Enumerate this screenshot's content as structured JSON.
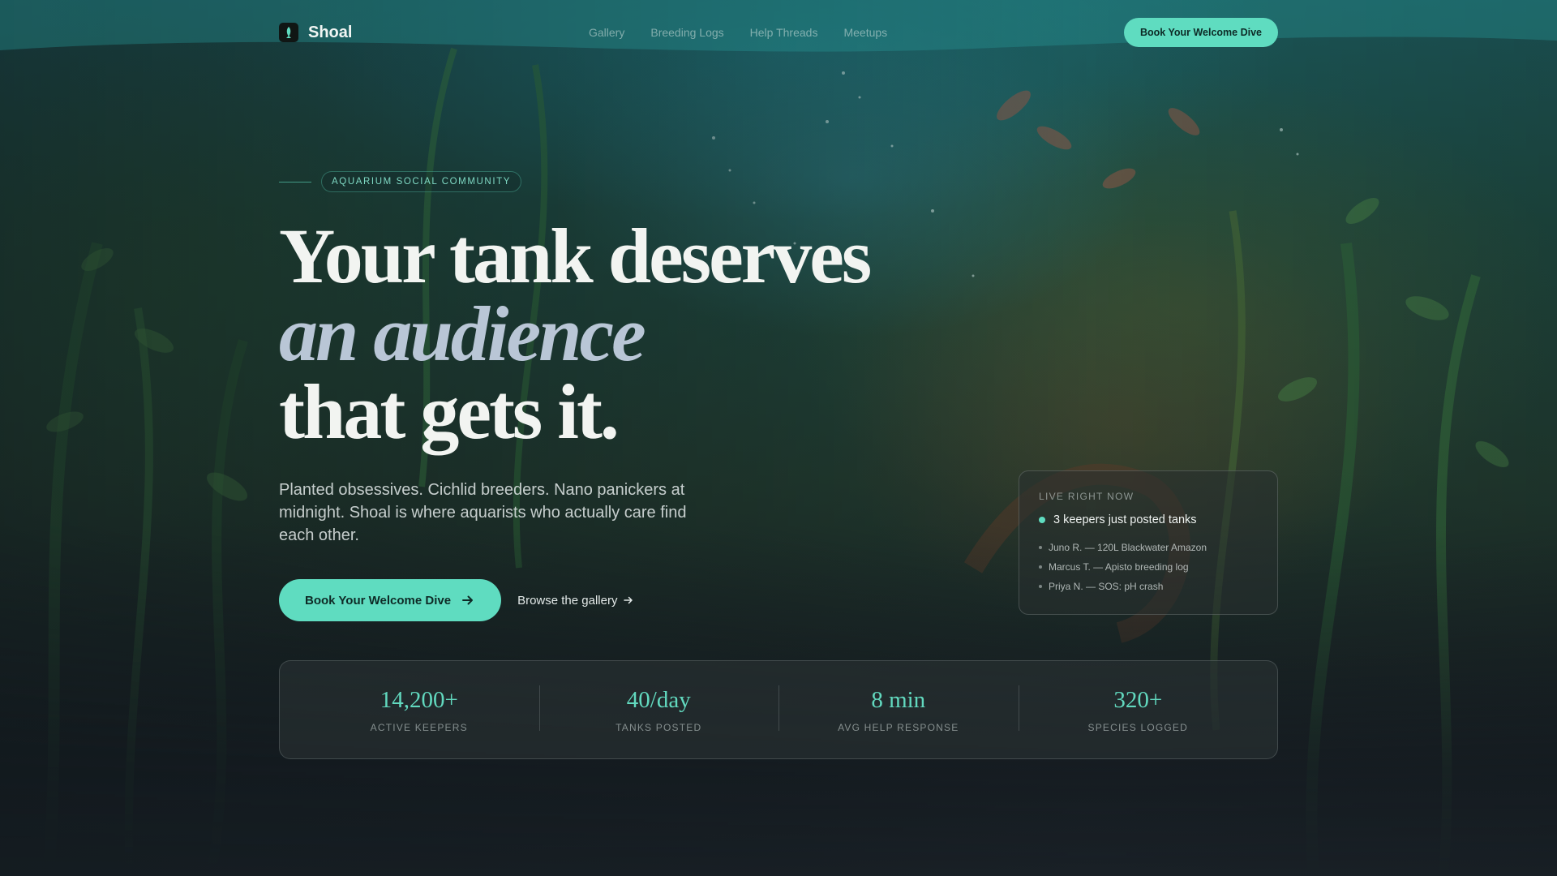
{
  "brand": {
    "name": "Shoal",
    "logo_icon": "fish-icon"
  },
  "nav": {
    "links": [
      "Gallery",
      "Breeding Logs",
      "Help Threads",
      "Meetups"
    ],
    "cta_label": "Book Your Welcome Dive"
  },
  "hero": {
    "eyebrow": "AQUARIUM SOCIAL COMMUNITY",
    "headline_line1": "Your tank deserves",
    "headline_line2": "an audience",
    "headline_line3": "that gets it.",
    "lede": "Planted obsessives. Cichlid breeders. Nano panickers at midnight. Shoal is where aquarists who actually care find each other.",
    "primary_cta": "Book Your Welcome Dive",
    "primary_cta_icon": "arrow-right-icon",
    "secondary_cta": "Browse the gallery",
    "secondary_cta_icon": "arrow-right-icon"
  },
  "live": {
    "title": "LIVE RIGHT NOW",
    "headline": "3 keepers just posted tanks",
    "items": [
      "Juno R. — 120L Blackwater Amazon",
      "Marcus T. — Apisto breeding log",
      "Priya N. — SOS: pH crash"
    ]
  },
  "stats": [
    {
      "value": "14,200+",
      "label": "ACTIVE KEEPERS"
    },
    {
      "value": "40/day",
      "label": "TANKS POSTED"
    },
    {
      "value": "8 min",
      "label": "AVG HELP RESPONSE"
    },
    {
      "value": "320+",
      "label": "SPECIES LOGGED"
    }
  ],
  "colors": {
    "accent": "#5fdcc0",
    "headline": "#f2f4f1",
    "headline_italic": "#b9c6d6"
  }
}
